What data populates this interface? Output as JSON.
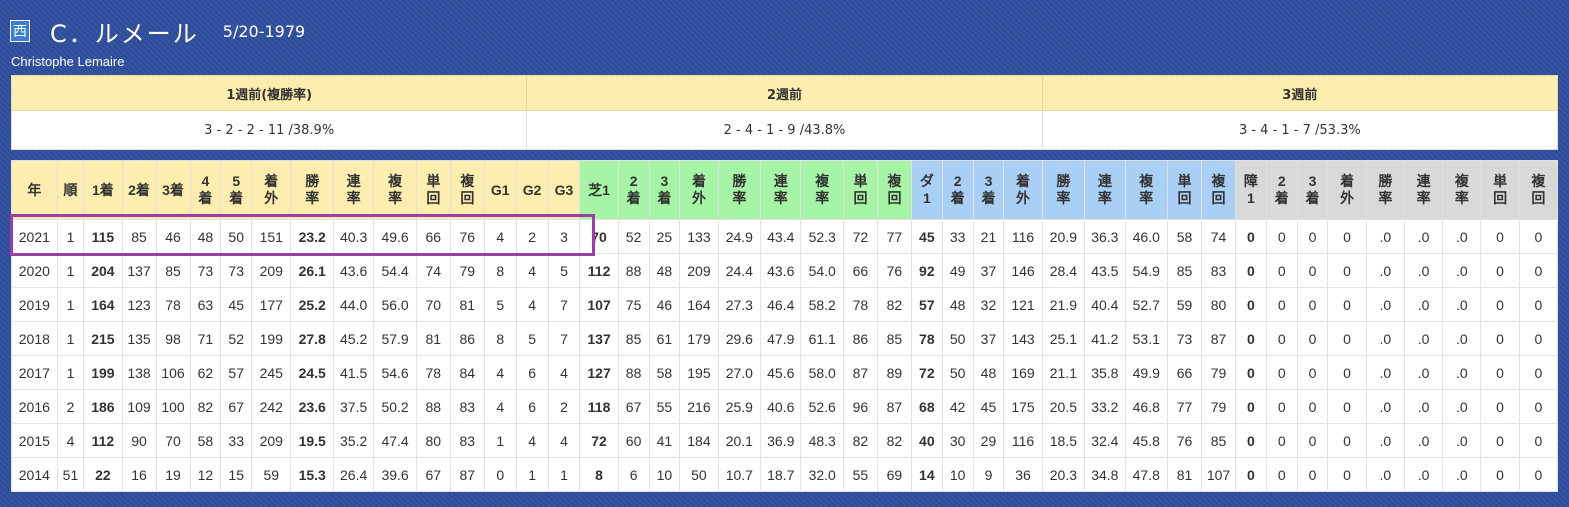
{
  "header": {
    "region_badge": "西",
    "name": "C．ルメール",
    "birthdate": "5/20-1979",
    "english_name": "Christophe Lemaire"
  },
  "recent_form": {
    "headers": [
      "1週前(複勝率)",
      "2週前",
      "3週前"
    ],
    "values": [
      "3 - 2 - 2 - 11 /38.9%",
      "2 - 4 - 1 - 9 /43.8%",
      "3 - 4 - 1 - 7 /53.3%"
    ]
  },
  "stats": {
    "columns": [
      {
        "l1": "年",
        "l2": "",
        "g": "y"
      },
      {
        "l1": "順",
        "l2": "",
        "g": "y"
      },
      {
        "l1": "1着",
        "l2": "",
        "g": "y"
      },
      {
        "l1": "2着",
        "l2": "",
        "g": "y"
      },
      {
        "l1": "3着",
        "l2": "",
        "g": "y"
      },
      {
        "l1": "4",
        "l2": "着",
        "g": "y"
      },
      {
        "l1": "5",
        "l2": "着",
        "g": "y"
      },
      {
        "l1": "着",
        "l2": "外",
        "g": "y"
      },
      {
        "l1": "勝",
        "l2": "率",
        "g": "y"
      },
      {
        "l1": "連",
        "l2": "率",
        "g": "y"
      },
      {
        "l1": "複",
        "l2": "率",
        "g": "y"
      },
      {
        "l1": "単",
        "l2": "回",
        "g": "y"
      },
      {
        "l1": "複",
        "l2": "回",
        "g": "y"
      },
      {
        "l1": "G1",
        "l2": "",
        "g": "y"
      },
      {
        "l1": "G2",
        "l2": "",
        "g": "y"
      },
      {
        "l1": "G3",
        "l2": "",
        "g": "y"
      },
      {
        "l1": "芝1",
        "l2": "",
        "g": "g"
      },
      {
        "l1": "2",
        "l2": "着",
        "g": "g"
      },
      {
        "l1": "3",
        "l2": "着",
        "g": "g"
      },
      {
        "l1": "着",
        "l2": "外",
        "g": "g"
      },
      {
        "l1": "勝",
        "l2": "率",
        "g": "g"
      },
      {
        "l1": "連",
        "l2": "率",
        "g": "g"
      },
      {
        "l1": "複",
        "l2": "率",
        "g": "g"
      },
      {
        "l1": "単",
        "l2": "回",
        "g": "g"
      },
      {
        "l1": "複",
        "l2": "回",
        "g": "g"
      },
      {
        "l1": "ダ",
        "l2": "1",
        "g": "b"
      },
      {
        "l1": "2",
        "l2": "着",
        "g": "b"
      },
      {
        "l1": "3",
        "l2": "着",
        "g": "b"
      },
      {
        "l1": "着",
        "l2": "外",
        "g": "b"
      },
      {
        "l1": "勝",
        "l2": "率",
        "g": "b"
      },
      {
        "l1": "連",
        "l2": "率",
        "g": "b"
      },
      {
        "l1": "複",
        "l2": "率",
        "g": "b"
      },
      {
        "l1": "単",
        "l2": "回",
        "g": "b"
      },
      {
        "l1": "複",
        "l2": "回",
        "g": "b"
      },
      {
        "l1": "障",
        "l2": "1",
        "g": "s"
      },
      {
        "l1": "2",
        "l2": "着",
        "g": "s"
      },
      {
        "l1": "3",
        "l2": "着",
        "g": "s"
      },
      {
        "l1": "着",
        "l2": "外",
        "g": "s"
      },
      {
        "l1": "勝",
        "l2": "率",
        "g": "s"
      },
      {
        "l1": "連",
        "l2": "率",
        "g": "s"
      },
      {
        "l1": "複",
        "l2": "率",
        "g": "s"
      },
      {
        "l1": "単",
        "l2": "回",
        "g": "s"
      },
      {
        "l1": "複",
        "l2": "回",
        "g": "s"
      }
    ],
    "bold_columns": [
      2,
      8,
      16,
      25,
      34
    ],
    "column_widths": [
      43,
      25,
      36,
      32,
      32,
      29,
      29,
      37,
      40,
      38,
      40,
      32,
      32,
      30,
      30,
      30,
      36,
      29,
      29,
      36,
      40,
      38,
      40,
      32,
      32,
      29,
      29,
      29,
      36,
      40,
      38,
      40,
      32,
      32,
      29,
      29,
      29,
      36,
      36,
      36,
      36,
      36,
      36
    ],
    "rows": [
      [
        "2021",
        "1",
        "115",
        "85",
        "46",
        "48",
        "50",
        "151",
        "23.2",
        "40.3",
        "49.6",
        "66",
        "76",
        "4",
        "2",
        "3",
        "70",
        "52",
        "25",
        "133",
        "24.9",
        "43.4",
        "52.3",
        "72",
        "77",
        "45",
        "33",
        "21",
        "116",
        "20.9",
        "36.3",
        "46.0",
        "58",
        "74",
        "0",
        "0",
        "0",
        "0",
        ".0",
        ".0",
        ".0",
        "0",
        "0"
      ],
      [
        "2020",
        "1",
        "204",
        "137",
        "85",
        "73",
        "73",
        "209",
        "26.1",
        "43.6",
        "54.4",
        "74",
        "79",
        "8",
        "4",
        "5",
        "112",
        "88",
        "48",
        "209",
        "24.4",
        "43.6",
        "54.0",
        "66",
        "76",
        "92",
        "49",
        "37",
        "146",
        "28.4",
        "43.5",
        "54.9",
        "85",
        "83",
        "0",
        "0",
        "0",
        "0",
        ".0",
        ".0",
        ".0",
        "0",
        "0"
      ],
      [
        "2019",
        "1",
        "164",
        "123",
        "78",
        "63",
        "45",
        "177",
        "25.2",
        "44.0",
        "56.0",
        "70",
        "81",
        "5",
        "4",
        "7",
        "107",
        "75",
        "46",
        "164",
        "27.3",
        "46.4",
        "58.2",
        "78",
        "82",
        "57",
        "48",
        "32",
        "121",
        "21.9",
        "40.4",
        "52.7",
        "59",
        "80",
        "0",
        "0",
        "0",
        "0",
        ".0",
        ".0",
        ".0",
        "0",
        "0"
      ],
      [
        "2018",
        "1",
        "215",
        "135",
        "98",
        "71",
        "52",
        "199",
        "27.8",
        "45.2",
        "57.9",
        "81",
        "86",
        "8",
        "5",
        "7",
        "137",
        "85",
        "61",
        "179",
        "29.6",
        "47.9",
        "61.1",
        "86",
        "85",
        "78",
        "50",
        "37",
        "143",
        "25.1",
        "41.2",
        "53.1",
        "73",
        "87",
        "0",
        "0",
        "0",
        "0",
        ".0",
        ".0",
        ".0",
        "0",
        "0"
      ],
      [
        "2017",
        "1",
        "199",
        "138",
        "106",
        "62",
        "57",
        "245",
        "24.5",
        "41.5",
        "54.6",
        "78",
        "84",
        "4",
        "6",
        "4",
        "127",
        "88",
        "58",
        "195",
        "27.0",
        "45.6",
        "58.0",
        "87",
        "89",
        "72",
        "50",
        "48",
        "169",
        "21.1",
        "35.8",
        "49.9",
        "66",
        "79",
        "0",
        "0",
        "0",
        "0",
        ".0",
        ".0",
        ".0",
        "0",
        "0"
      ],
      [
        "2016",
        "2",
        "186",
        "109",
        "100",
        "82",
        "67",
        "242",
        "23.6",
        "37.5",
        "50.2",
        "88",
        "83",
        "4",
        "6",
        "2",
        "118",
        "67",
        "55",
        "216",
        "25.9",
        "40.6",
        "52.6",
        "96",
        "87",
        "68",
        "42",
        "45",
        "175",
        "20.5",
        "33.2",
        "46.8",
        "77",
        "79",
        "0",
        "0",
        "0",
        "0",
        ".0",
        ".0",
        ".0",
        "0",
        "0"
      ],
      [
        "2015",
        "4",
        "112",
        "90",
        "70",
        "58",
        "33",
        "209",
        "19.5",
        "35.2",
        "47.4",
        "80",
        "83",
        "1",
        "4",
        "4",
        "72",
        "60",
        "41",
        "184",
        "20.1",
        "36.9",
        "48.3",
        "82",
        "82",
        "40",
        "30",
        "29",
        "116",
        "18.5",
        "32.4",
        "45.8",
        "76",
        "85",
        "0",
        "0",
        "0",
        "0",
        ".0",
        ".0",
        ".0",
        "0",
        "0"
      ],
      [
        "2014",
        "51",
        "22",
        "16",
        "19",
        "12",
        "15",
        "59",
        "15.3",
        "26.4",
        "39.6",
        "67",
        "87",
        "0",
        "1",
        "1",
        "8",
        "6",
        "10",
        "50",
        "10.7",
        "18.7",
        "32.0",
        "55",
        "69",
        "14",
        "10",
        "9",
        "36",
        "20.3",
        "34.8",
        "47.8",
        "81",
        "107",
        "0",
        "0",
        "0",
        "0",
        ".0",
        ".0",
        ".0",
        "0",
        "0"
      ]
    ]
  },
  "colors": {
    "background": "#2f4f9e",
    "header_yellow": "#fdeeb0",
    "turf_green": "#a6f5a6",
    "dirt_blue": "#a9cff5",
    "jump_gray": "#d9d9d9",
    "highlight": "#9b3fa6"
  }
}
